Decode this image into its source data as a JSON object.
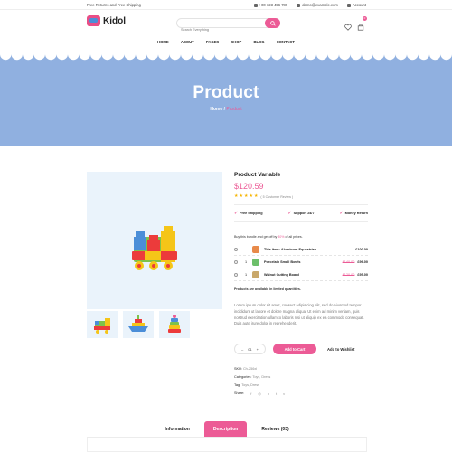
{
  "topbar": {
    "promo": "Free Returns and Free Shipping",
    "phone": "+00 123 456 789",
    "email": "demo@example.com",
    "account": "Account"
  },
  "header": {
    "logo_text": "Kidol",
    "search_placeholder": "Search Everything",
    "cart_count": "0"
  },
  "nav": [
    "HOME",
    "ABOUT",
    "PAGES",
    "SHOP",
    "BLOG",
    "CONTACT"
  ],
  "banner": {
    "title": "Product",
    "breadcrumb_home": "Home",
    "breadcrumb_sep": " / ",
    "breadcrumb_current": "Product",
    "color": "#90b0e0"
  },
  "product": {
    "title": "Product Variable",
    "price": "$120.59",
    "rating": 5,
    "reviews_text": "( 5 Customer Review )",
    "features": [
      "Free Shipping",
      "Support 24/7",
      "Money Return"
    ],
    "bundle_title_pre": "Buy this bundle and get off by ",
    "bundle_title_hl": "30%",
    "bundle_title_post": " of all prices.",
    "bundle": [
      {
        "qty": "",
        "name": "This item: Aluminum Equestrian",
        "old": "",
        "price": "£100.00",
        "color": "#e88a4a"
      },
      {
        "qty": "1",
        "name": "Porcelain Small Bowls",
        "old": "£140.00",
        "price": "£96.00",
        "color": "#6cbf6a"
      },
      {
        "qty": "1",
        "name": "Walnut Cutting Board",
        "old": "£120.00",
        "price": "£95.00",
        "color": "#c9a86a"
      }
    ],
    "limited": "Products are available in limited quantities.",
    "description": "Lorem ipsum dolor sit amet, consect adipisicing elit, sed do eiusmod tempor incididunt ut labore et dolore magna aliqua. Ut enim ad minim veniam, quis nostrud exercitation ullamco laboris nisi ut aliquip ex ea commodo consequat. Duis aute irure dolor in reprehenderit.",
    "quantity": "01",
    "add_to_cart": "Add to Cart",
    "wishlist": "Add to Wishlist",
    "sku_label": "SKU:",
    "sku": "Ch-256xl",
    "categories_label": "Categories:",
    "categories": "Toys, Dress",
    "tag_label": "Tag:",
    "tag": "Toys, Dress",
    "share_label": "Share:"
  },
  "tabs": [
    "Information",
    "Description",
    "Reviews (03)"
  ],
  "active_tab": 1,
  "colors": {
    "accent": "#ec5b96",
    "gallery_bg": "#eaf3fb"
  }
}
